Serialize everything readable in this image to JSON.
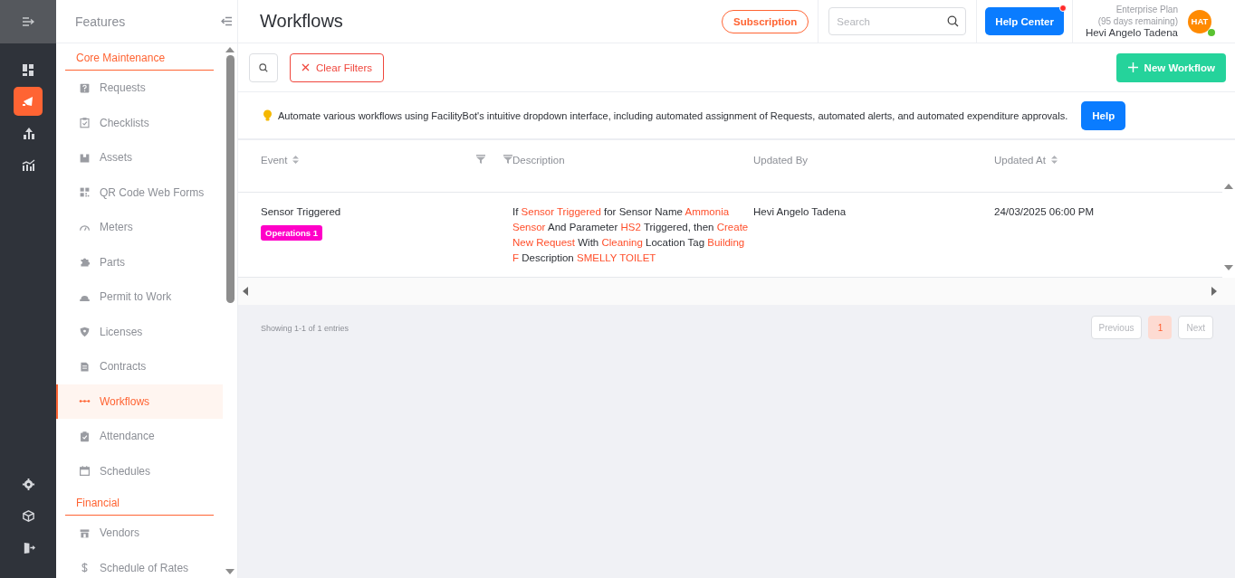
{
  "rail": {
    "items": [
      {
        "kind": "dashboard",
        "selected": false
      },
      {
        "kind": "megaphone",
        "selected": true
      },
      {
        "kind": "upload",
        "selected": false
      },
      {
        "kind": "analytics",
        "selected": false
      }
    ],
    "bottom_items": [
      {
        "kind": "settings"
      },
      {
        "kind": "cube"
      },
      {
        "kind": "logout"
      }
    ]
  },
  "features": {
    "title": "Features",
    "sections": [
      {
        "title": "Core Maintenance",
        "items": [
          {
            "label": "Requests",
            "kind": "question",
            "selected": false
          },
          {
            "label": "Checklists",
            "kind": "clipboard",
            "selected": false
          },
          {
            "label": "Assets",
            "kind": "box",
            "selected": false
          },
          {
            "label": "QR Code Web Forms",
            "kind": "qr",
            "selected": false
          },
          {
            "label": "Meters",
            "kind": "gauge",
            "selected": false
          },
          {
            "label": "Parts",
            "kind": "puzzle",
            "selected": false
          },
          {
            "label": "Permit to Work",
            "kind": "helmet",
            "selected": false
          },
          {
            "label": "Licenses",
            "kind": "shield",
            "selected": false
          },
          {
            "label": "Contracts",
            "kind": "document",
            "selected": false
          },
          {
            "label": "Workflows",
            "kind": "flow",
            "selected": true
          },
          {
            "label": "Attendance",
            "kind": "attendance",
            "selected": false
          },
          {
            "label": "Schedules",
            "kind": "calendar",
            "selected": false
          }
        ]
      },
      {
        "title": "Financial",
        "items": [
          {
            "label": "Vendors",
            "kind": "store",
            "selected": false
          },
          {
            "label": "Schedule of Rates",
            "kind": "dollar",
            "selected": false
          }
        ]
      }
    ]
  },
  "header": {
    "title": "Workflows",
    "subscription": "Subscription",
    "search": {
      "placeholder": "Search"
    },
    "help_center": {
      "label": "Help Center",
      "notification": true
    },
    "plan": "Enterprise Plan",
    "plan_remaining": "(95 days remaining)",
    "user_name": "Hevi Angelo Tadena",
    "avatar": {
      "initials": "HAT",
      "online": true
    }
  },
  "toolbar": {
    "clear_filters": "Clear Filters",
    "new_workflow": "New Workflow"
  },
  "notice": {
    "text": "Automate various workflows using FacilityBot's intuitive dropdown interface, including automated assignment of Requests, automated alerts, and automated expenditure approvals.",
    "help": "Help"
  },
  "table": {
    "columns": [
      {
        "label": "Event",
        "sortable": true,
        "filterable": true
      },
      {
        "label": "Description",
        "sortable": false,
        "filterable": false
      },
      {
        "label": "Updated By",
        "sortable": false,
        "filterable": false
      },
      {
        "label": "Updated At",
        "sortable": true,
        "filterable": false
      }
    ],
    "rows": [
      {
        "event": "Sensor Triggered",
        "tag": {
          "label": "Operations 1",
          "color": "#ff00c8"
        },
        "description": [
          {
            "text": "If",
            "highlight": false
          },
          {
            "text": "Sensor Triggered",
            "highlight": true
          },
          {
            "text": "for Sensor Name",
            "highlight": false
          },
          {
            "text": "Ammonia Sensor",
            "highlight": true
          },
          {
            "text": "And Parameter",
            "highlight": false
          },
          {
            "text": "HS2",
            "highlight": true
          },
          {
            "text": "Triggered, then",
            "highlight": false
          },
          {
            "text": "Create New Request",
            "highlight": true
          },
          {
            "text": "With",
            "highlight": false
          },
          {
            "text": "Cleaning",
            "highlight": true
          },
          {
            "text": "Location Tag",
            "highlight": false
          },
          {
            "text": "Building F",
            "highlight": true
          },
          {
            "text": "Description",
            "highlight": false
          },
          {
            "text": "SMELLY TOILET",
            "highlight": true
          }
        ],
        "updated_by": "Hevi Angelo Tadena",
        "updated_at": "24/03/2025 06:00 PM"
      }
    ]
  },
  "footer": {
    "summary": "Showing 1-1 of 1 entries",
    "previous": {
      "label": "Previous",
      "disabled": true
    },
    "pages": [
      {
        "label": "1",
        "selected": true
      }
    ],
    "next": {
      "label": "Next",
      "disabled": true
    }
  }
}
